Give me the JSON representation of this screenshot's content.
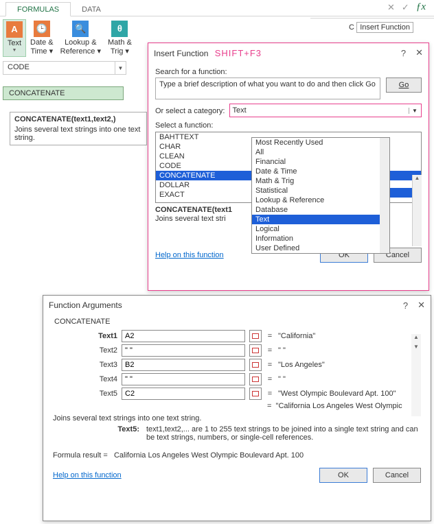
{
  "ribbon": {
    "tabs": [
      "FORMULAS",
      "DATA"
    ],
    "activeTab": 0,
    "buttons": [
      {
        "label1": "Text",
        "label2": "",
        "iconChar": "A",
        "iconClass": "orange",
        "active": true
      },
      {
        "label1": "Date &",
        "label2": "Time ▾",
        "iconChar": "🕒",
        "iconClass": "orange"
      },
      {
        "label1": "Lookup &",
        "label2": "Reference ▾",
        "iconChar": "🔍",
        "iconClass": "blue"
      },
      {
        "label1": "Math &",
        "label2": "Trig ▾",
        "iconChar": "θ",
        "iconClass": "teal"
      }
    ],
    "fxTooltip": "Insert Function",
    "cellRef": "C"
  },
  "cellDropdown": {
    "current": "CODE",
    "items": [
      "CONCATENATE"
    ]
  },
  "sigTip": {
    "sig": "CONCATENATE(text1,text2,)",
    "desc": "Joins several text strings into one text string."
  },
  "insertFn": {
    "title": "Insert Function",
    "shortcut": "SHIFT+F3",
    "searchLabel": "Search for a function:",
    "searchPlaceholder": "Type a brief description of what you want to do and then click Go",
    "goLabel": "Go",
    "catLabel": "Or select a category:",
    "catSelected": "Text",
    "selectLabel": "Select a function:",
    "functions": [
      "BAHTTEXT",
      "CHAR",
      "CLEAN",
      "CODE",
      "CONCATENATE",
      "DOLLAR",
      "EXACT"
    ],
    "selectedFn": "CONCATENATE",
    "sig": "CONCATENATE(text1",
    "desc": "Joins several text stri",
    "helpLink": "Help on this function",
    "ok": "OK",
    "cancel": "Cancel",
    "categories": [
      "Most Recently Used",
      "All",
      "Financial",
      "Date & Time",
      "Math & Trig",
      "Statistical",
      "Lookup & Reference",
      "Database",
      "Text",
      "Logical",
      "Information",
      "User Defined"
    ],
    "catHighlight": "Text"
  },
  "fnArgs": {
    "title": "Function Arguments",
    "fn": "CONCATENATE",
    "args": [
      {
        "label": "Text1",
        "bold": true,
        "value": "A2",
        "result": "\"California\""
      },
      {
        "label": "Text2",
        "bold": false,
        "value": "\" \"",
        "result": "\" \""
      },
      {
        "label": "Text3",
        "bold": false,
        "value": "B2",
        "result": "\"Los Angeles\""
      },
      {
        "label": "Text4",
        "bold": false,
        "value": "\" \"",
        "result": "\" \""
      },
      {
        "label": "Text5",
        "bold": false,
        "value": "C2",
        "result": "\"West Olympic Boulevard Apt. 100\""
      }
    ],
    "preview": "\"California Los Angeles West Olympic",
    "desc": "Joins several text strings into one text string.",
    "argDesc": {
      "name": "Text5:",
      "text": "text1,text2,... are 1 to 255 text strings to be joined into a single text string and can be text strings, numbers, or single-cell references."
    },
    "resultLabel": "Formula result =",
    "resultValue": "California Los Angeles West Olympic Boulevard Apt. 100",
    "helpLink": "Help on this function",
    "ok": "OK",
    "cancel": "Cancel"
  }
}
